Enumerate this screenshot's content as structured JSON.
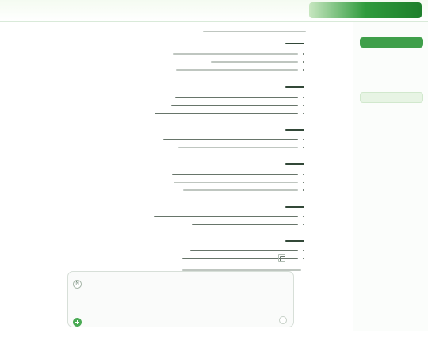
{
  "app": {
    "banner_logo": "",
    "banner_text": ""
  },
  "sidebar": {
    "title": "",
    "new_chat_label": "",
    "section_1": "",
    "active_item": "",
    "section_2": "",
    "items": [
      "",
      "",
      "",
      ""
    ]
  },
  "chat": {
    "copy_icon": "copy-icon"
  },
  "input": {
    "placeholder": "",
    "mode_icon": "N",
    "attach_icon": "paperclip-icon",
    "send_icon": "send-icon"
  },
  "footer": {
    "text": ""
  },
  "colors": {
    "brand_green": "#3f9f4a",
    "light_green": "#e7f4e4",
    "text_dark": "#273e2d",
    "text_light": "#8b978d"
  }
}
